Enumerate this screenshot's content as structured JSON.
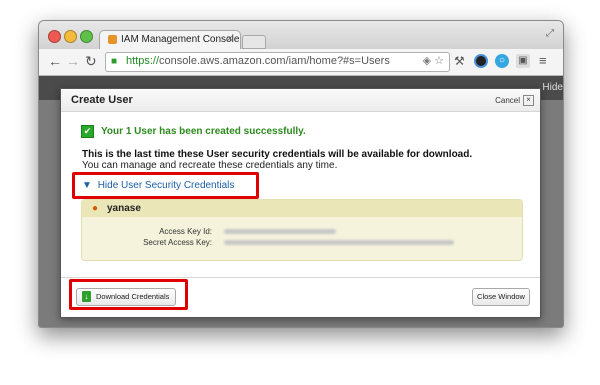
{
  "browser": {
    "tab_title": "IAM Management Console",
    "tab_close": "×",
    "url_scheme": "https://",
    "url_rest": "console.aws.amazon.com/iam/home?#s=Users",
    "page_fragment": "Hide"
  },
  "modal": {
    "title": "Create User",
    "cancel_label": "Cancel",
    "close_glyph": "×",
    "success_message": "Your 1 User has been created successfully.",
    "warning_bold": "This is the last time these User security credentials will be available for download.",
    "warning_note": "You can manage and recreate these credentials any time.",
    "toggle_arrow": "▼",
    "toggle_label": "Hide User Security Credentials",
    "user": {
      "name": "yanase",
      "access_key_label": "Access Key Id:",
      "secret_key_label": "Secret Access Key:"
    },
    "download_button": "Download Credentials",
    "close_button": "Close Window"
  },
  "colors": {
    "highlight": "#e00000",
    "success": "#2d8a1f",
    "link": "#1c5fa8"
  },
  "icons": [
    "lock-icon",
    "check-icon",
    "person-icon",
    "download-icon",
    "close-icon"
  ]
}
